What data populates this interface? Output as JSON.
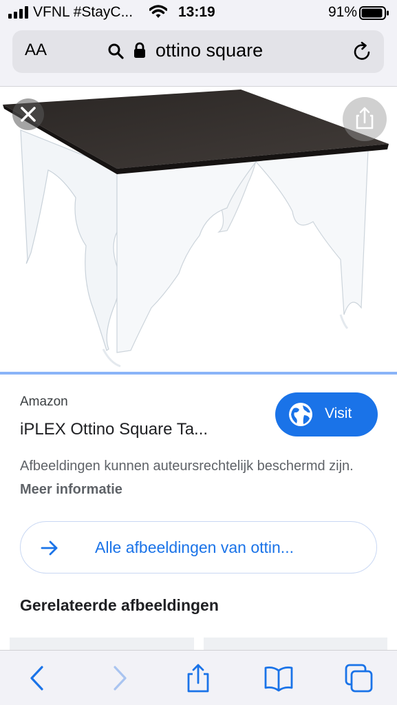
{
  "status_bar": {
    "carrier": "VFNL #StayC...",
    "time": "13:19",
    "battery_percent": "91%",
    "battery_level": 0.91,
    "signal_icon": "signal-bars-icon",
    "wifi_icon": "wifi-icon"
  },
  "address_bar": {
    "text_size_button": "AA",
    "url_text": "ottino square",
    "search_icon": "search-icon",
    "lock_icon": "lock-icon",
    "reload_icon": "reload-icon"
  },
  "image_viewer": {
    "close_icon": "close-icon",
    "share_icon": "share-icon",
    "image_subject": "square table with black top and clear acrylic legs"
  },
  "result": {
    "source": "Amazon",
    "title": "iPLEX Ottino Square Ta...",
    "visit_label": "Visit",
    "visit_icon": "globe-icon",
    "notice_text": "Afbeeldingen kunnen auteursrechtelijk beschermd zijn.",
    "notice_link": "Meer informatie"
  },
  "all_images": {
    "label": "Alle afbeeldingen van ottin...",
    "icon": "arrow-right-icon"
  },
  "related": {
    "heading": "Gerelateerde afbeeldingen"
  },
  "toolbar": {
    "items": [
      "back-icon",
      "forward-icon",
      "share-icon",
      "bookmarks-icon",
      "tabs-icon"
    ]
  },
  "colors": {
    "accent": "#1a73e8",
    "toolbar_icon": "#1a73e8",
    "disabled_icon": "#a9c4f0",
    "chrome_bg": "#f2f2f7"
  }
}
